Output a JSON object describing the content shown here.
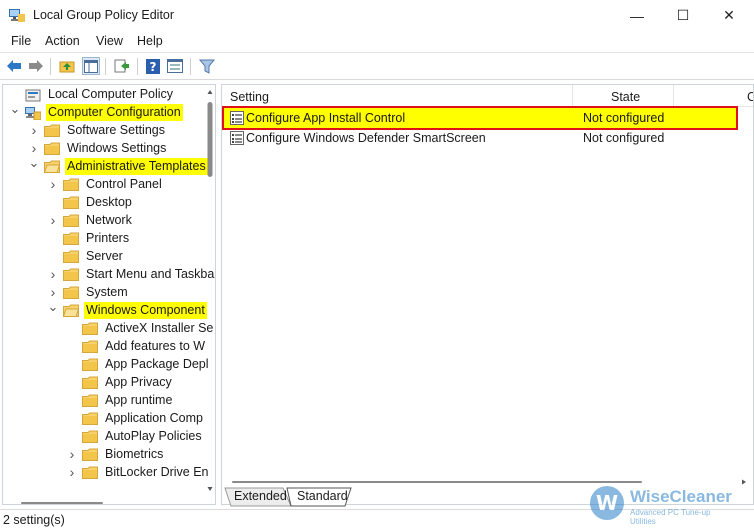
{
  "window": {
    "title": "Local Group Policy Editor",
    "controls": {
      "minimize": "—",
      "maximize": "☐",
      "close": "✕"
    }
  },
  "menu": [
    "File",
    "Action",
    "View",
    "Help"
  ],
  "toolbar": {
    "icons": [
      "back-arrow-icon",
      "forward-arrow-icon",
      "up-folder-icon",
      "show-hide-tree-icon",
      "export-list-icon",
      "help-icon",
      "properties-icon",
      "filter-icon"
    ]
  },
  "tree": {
    "items": [
      {
        "label": "Local Computer Policy",
        "level": 0,
        "expander": "none",
        "icon": "computer-policy-icon",
        "highlight": false
      },
      {
        "label": "Computer Configuration",
        "level": 0,
        "expander": "expanded",
        "icon": "computer-config-icon",
        "highlight": true
      },
      {
        "label": "Software Settings",
        "level": 1,
        "expander": "collapsed",
        "icon": "folder-icon",
        "highlight": false
      },
      {
        "label": "Windows Settings",
        "level": 1,
        "expander": "collapsed",
        "icon": "folder-icon",
        "highlight": false
      },
      {
        "label": "Administrative Templates",
        "level": 1,
        "expander": "expanded",
        "icon": "folder-open-icon",
        "highlight": true
      },
      {
        "label": "Control Panel",
        "level": 2,
        "expander": "collapsed",
        "icon": "folder-icon",
        "highlight": false
      },
      {
        "label": "Desktop",
        "level": 2,
        "expander": "none",
        "icon": "folder-icon",
        "highlight": false
      },
      {
        "label": "Network",
        "level": 2,
        "expander": "collapsed",
        "icon": "folder-icon",
        "highlight": false
      },
      {
        "label": "Printers",
        "level": 2,
        "expander": "none",
        "icon": "folder-icon",
        "highlight": false
      },
      {
        "label": "Server",
        "level": 2,
        "expander": "none",
        "icon": "folder-icon",
        "highlight": false
      },
      {
        "label": "Start Menu and Taskba",
        "level": 2,
        "expander": "collapsed",
        "icon": "folder-icon",
        "highlight": false
      },
      {
        "label": "System",
        "level": 2,
        "expander": "collapsed",
        "icon": "folder-icon",
        "highlight": false
      },
      {
        "label": "Windows Component",
        "level": 2,
        "expander": "expanded",
        "icon": "folder-open-icon",
        "highlight": true
      },
      {
        "label": "ActiveX Installer Se",
        "level": 3,
        "expander": "none",
        "icon": "folder-icon",
        "highlight": false
      },
      {
        "label": "Add features to W",
        "level": 3,
        "expander": "none",
        "icon": "folder-icon",
        "highlight": false
      },
      {
        "label": "App Package Depl",
        "level": 3,
        "expander": "none",
        "icon": "folder-icon",
        "highlight": false
      },
      {
        "label": "App Privacy",
        "level": 3,
        "expander": "none",
        "icon": "folder-icon",
        "highlight": false
      },
      {
        "label": "App runtime",
        "level": 3,
        "expander": "none",
        "icon": "folder-icon",
        "highlight": false
      },
      {
        "label": "Application Comp",
        "level": 3,
        "expander": "none",
        "icon": "folder-icon",
        "highlight": false
      },
      {
        "label": "AutoPlay Policies",
        "level": 3,
        "expander": "none",
        "icon": "folder-icon",
        "highlight": false
      },
      {
        "label": "Biometrics",
        "level": 3,
        "expander": "collapsed",
        "icon": "folder-icon",
        "highlight": false
      },
      {
        "label": "BitLocker Drive En",
        "level": 3,
        "expander": "collapsed",
        "icon": "folder-icon",
        "highlight": false
      }
    ]
  },
  "list": {
    "columns": [
      "Setting",
      "State",
      "C"
    ],
    "rows": [
      {
        "setting": "Configure App Install Control",
        "state": "Not configured",
        "selected": true
      },
      {
        "setting": "Configure Windows Defender SmartScreen",
        "state": "Not configured",
        "selected": false
      }
    ]
  },
  "tabs": [
    "Extended",
    "Standard"
  ],
  "status": "2 setting(s)",
  "watermark": {
    "name": "WiseCleaner",
    "tagline": "Advanced PC Tune-up Utilities",
    "logo_letter": "W"
  },
  "colors": {
    "highlight": "#ffff00",
    "selection_border": "#e0101a",
    "folder": "#f3c64b",
    "accent": "#2a80c8"
  }
}
